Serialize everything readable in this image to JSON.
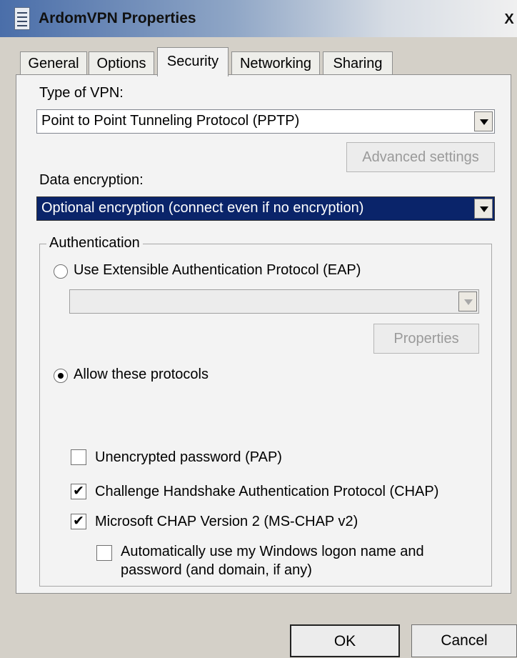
{
  "window": {
    "title": "ArdomVPN Properties",
    "close_label": "X"
  },
  "tabs": [
    {
      "label": "General"
    },
    {
      "label": "Options"
    },
    {
      "label": "Security"
    },
    {
      "label": "Networking"
    },
    {
      "label": "Sharing"
    }
  ],
  "active_tab": "Security",
  "security": {
    "vpn_type_label": "Type of VPN:",
    "vpn_type_value": "Point to Point Tunneling Protocol (PPTP)",
    "advanced_settings_label": "Advanced settings",
    "data_encryption_label": "Data encryption:",
    "data_encryption_value": "Optional encryption (connect even if no encryption)",
    "authentication": {
      "legend": "Authentication",
      "eap_option_label": "Use Extensible Authentication Protocol (EAP)",
      "eap_selected": false,
      "eap_method_value": "",
      "properties_label": "Properties",
      "allow_protocols_label": "Allow these protocols",
      "allow_protocols_selected": true,
      "protocols": [
        {
          "label": "Unencrypted password (PAP)",
          "checked": false,
          "check_mark": ""
        },
        {
          "label": "Challenge Handshake Authentication Protocol (CHAP)",
          "checked": true,
          "check_mark": "✔"
        },
        {
          "label": "Microsoft CHAP Version 2 (MS-CHAP v2)",
          "checked": true,
          "check_mark": "✔"
        }
      ],
      "auto_logon_label_line1": "Automatically use my Windows logon name and",
      "auto_logon_label_line2": "password (and domain, if any)",
      "auto_logon_checked": false
    }
  },
  "footer": {
    "ok_label": "OK",
    "cancel_label": "Cancel"
  },
  "colors": {
    "selection_bg": "#0a246a",
    "dialog_bg": "#f3f3f3",
    "disabled_text": "#9a9a9a"
  }
}
